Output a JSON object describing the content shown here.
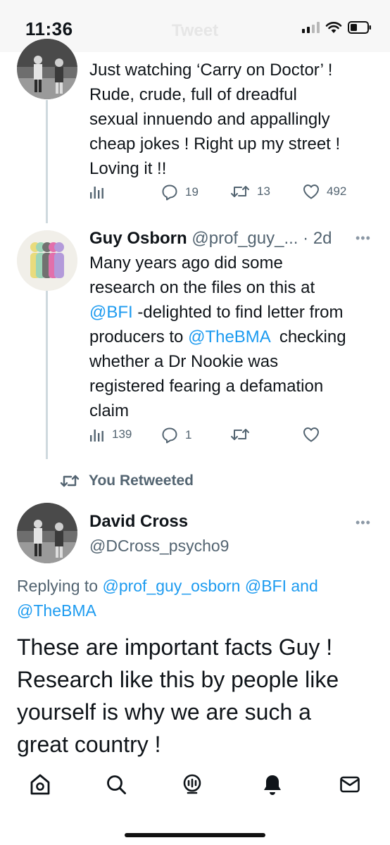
{
  "status_bar": {
    "time": "11:36",
    "title": "Tweet"
  },
  "tweets": [
    {
      "text": "Just watching ‘Carry on Doctor’ ! Rude, crude, full of dreadful sexual innuendo and appallingly cheap jokes ! Right up my street ! Loving it !!",
      "lines": [
        "Just watching ‘Carry on Doctor’ !",
        "Rude, crude, full of dreadful",
        "sexual innuendo and appallingly",
        "cheap jokes ! Right up my street !",
        "Loving it !!"
      ],
      "analytics_count": "",
      "reply_count": "19",
      "retweet_count": "13",
      "like_count": "492"
    },
    {
      "name": "Guy Osborn",
      "handle": "@prof_guy_...",
      "time": "· 2d",
      "lines": {
        "l1": "Many years ago did some",
        "l2": "research on the files on this at",
        "l3_link": "@BFI",
        "l3_text": " -delighted to find letter from",
        "l4_text": "producers to ",
        "l4_link": "@TheBMA",
        "l4_text2": "  checking",
        "l5": "whether a Dr Nookie was",
        "l6": "registered fearing a defamation",
        "l7": "claim"
      },
      "analytics_count": "139",
      "reply_count": "1",
      "retweet_count": "",
      "like_count": ""
    }
  ],
  "retweet_context": {
    "label": "You Retweeted"
  },
  "main_tweet": {
    "name": "David Cross",
    "handle": "@DCross_psycho9",
    "replying_prefix": "Replying to ",
    "replying_handle1": "@prof_guy_osborn",
    "replying_space": " ",
    "replying_handle2": "@BFI",
    "replying_and": " and",
    "replying_handle3": "@TheBMA",
    "lines": [
      "These are important facts Guy !",
      "Research like this by people like",
      "yourself is why we are such a",
      "great country !"
    ]
  },
  "bottom_nav": {
    "items": [
      "home-icon",
      "search-icon",
      "spaces-icon",
      "notifications-icon",
      "messages-icon"
    ]
  },
  "colors": {
    "link": "#1d9bf0",
    "muted": "#536471",
    "text": "#0f1419"
  }
}
